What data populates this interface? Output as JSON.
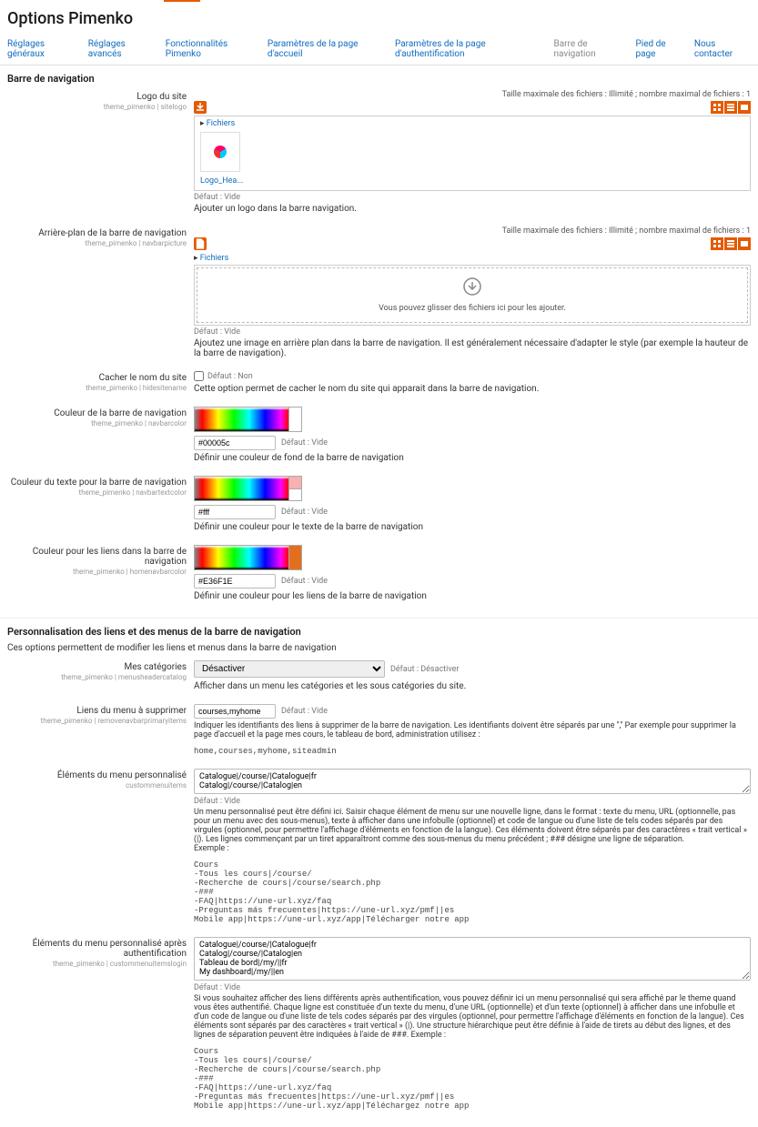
{
  "page_title": "Options Pimenko",
  "tabs": [
    {
      "label": "Réglages généraux"
    },
    {
      "label": "Réglages avancés"
    },
    {
      "label": "Fonctionnalités Pimenko"
    },
    {
      "label": "Paramètres de la page d'accueil"
    },
    {
      "label": "Paramètres de la page d'authentification"
    },
    {
      "label": "Barre de navigation",
      "active": true
    },
    {
      "label": "Pied de page"
    },
    {
      "label": "Nous contacter"
    }
  ],
  "section_nav": {
    "title": "Barre de navigation"
  },
  "logo": {
    "label": "Logo du site",
    "sub": "theme_pimenko | sitelogo",
    "file_limit": "Taille maximale des fichiers : Illimité ; nombre maximal de fichiers : 1",
    "folder": "Fichiers",
    "file_name": "Logo_Hea...",
    "default": "Défaut : Vide",
    "help": "Ajouter un logo dans la barre navigation."
  },
  "navbg": {
    "label": "Arrière-plan de la barre de navigation",
    "sub": "theme_pimenko | navbarpicture",
    "file_limit": "Taille maximale des fichiers : Illimité ; nombre maximal de fichiers : 1",
    "folder": "Fichiers",
    "drop_text": "Vous pouvez glisser des fichiers ici pour les ajouter.",
    "default": "Défaut : Vide",
    "help": "Ajoutez une image en arrière plan dans la barre de navigation. Il est généralement nécessaire d'adapter le style (par exemple la hauteur de la barre de navigation)."
  },
  "hidesitename": {
    "label": "Cacher le nom du site",
    "sub": "theme_pimenko | hidesitename",
    "default": "Défaut : Non",
    "help": "Cette option permet de cacher le nom du site qui apparait dans la barre de navigation."
  },
  "navbarcolor": {
    "label": "Couleur de la barre de navigation",
    "sub": "theme_pimenko | navbarcolor",
    "value": "#00005c",
    "default": "Défaut : Vide",
    "help": "Définir une couleur de fond de la barre de navigation",
    "swatch": "#00005c"
  },
  "navbartext": {
    "label": "Couleur du texte pour la barre de navigation",
    "sub": "theme_pimenko | navbartextcolor",
    "value": "#fff",
    "default": "Défaut : Vide",
    "help": "Définir une couleur pour le texte de la barre de navigation",
    "swatch1": "#f8b0b0",
    "swatch2": "#ffffff"
  },
  "navbarlink": {
    "label": "Couleur pour les liens dans la barre de navigation",
    "sub": "theme_pimenko | homenavbarcolor",
    "value": "#E36F1E",
    "default": "Défaut : Vide",
    "help": "Définir une couleur pour les liens de la barre de navigation",
    "swatch": "#E36F1E"
  },
  "section_links": {
    "title": "Personnalisation des liens et des menus de la barre de navigation",
    "desc": "Ces options permettent de modifier les liens et menus dans la barre de navigation"
  },
  "mycat": {
    "label": "Mes catégories",
    "sub": "theme_pimenko | menusheadercatalog",
    "value": "Désactiver",
    "default": "Défaut : Désactiver",
    "help": "Afficher dans un menu les catégories et les sous catégories du site."
  },
  "removebar": {
    "label": "Liens du menu à supprimer",
    "sub": "theme_pimenko | removenavbarprimaryitems",
    "value": "courses,myhome",
    "default": "Défaut : Vide",
    "help": "Indiquer les identifiants des liens à supprimer de la barre de navigation. Les identifiants doivent être séparés par une \",\" Par exemple pour supprimer la page d'accueil et la page mes cours, le tableau de bord, administration utilisez :",
    "example": "home,courses,myhome,siteadmin"
  },
  "custommenu": {
    "label": "Éléments du menu personnalisé",
    "sub": "custommenuitems",
    "value": "Catalogue|/course/|Catalogue|fr\nCatalog|/course/|Catalog|en",
    "default": "Défaut : Vide",
    "help": "Un menu personnalisé peut être défini ici. Saisir chaque élément de menu sur une nouvelle ligne, dans le format : texte du menu, URL (optionnelle, pas pour un menu avec des sous-menus), texte à afficher dans une infobulle (optionnel) et code de langue ou d'une liste de tels codes séparés par des virgules (optionnel, pour permettre l'affichage d'éléments en fonction de la langue). Ces éléments doivent être séparés par des caractères « trait vertical » (|). Les lignes commençant par un tiret apparaîtront comme des sous-menus du menu précédent ; ### désigne une ligne de séparation.\nExemple :",
    "example": "Cours\n-Tous les cours|/course/\n-Recherche de cours|/course/search.php\n-###\n-FAQ|https://une-url.xyz/faq\n-Preguntas más frecuentes|https://une-url.xyz/pmf||es\nMobile app|https://une-url.xyz/app|Télécharger notre app"
  },
  "custommenulogin": {
    "label": "Éléments du menu personnalisé après authentification",
    "sub": "theme_pimenko | custommenuitemslogin",
    "value": "Catalogue|/course/|Catalogue|fr\nCatalog|/course/|Catalog|en\nTableau de bord|/my/||fr\nMy dashboard|/my/||en",
    "default": "Défaut : Vide",
    "help": "Si vous souhaitez afficher des liens différents après authentification, vous pouvez définir ici un menu personnalisé qui sera affiché par le theme quand vous êtes authentifié. Chaque ligne est constituée d'un texte du menu, d'une URL (optionnelle) et d'un texte (optionnel) à afficher dans une infobulle et d'un code de langue ou d'une liste de tels codes séparés par des virgules (optionnel, pour permettre l'affichage d'éléments en fonction de la langue). Ces éléments sont séparés par des caractères « trait vertical » (|). Une structure hiérarchique peut être définie à l'aide de tirets au début des lignes, et des lignes de séparation peuvent être indiquées à l'aide de ###. Exemple :",
    "example": "Cours\n-Tous les cours|/course/\n-Recherche de cours|/course/search.php\n-###\n-FAQ|https://une-url.xyz/faq\n-Preguntas más frecuentes|https://une-url.xyz/pmf||es\nMobile app|https://une-url.xyz/app|Téléchargez notre app"
  }
}
